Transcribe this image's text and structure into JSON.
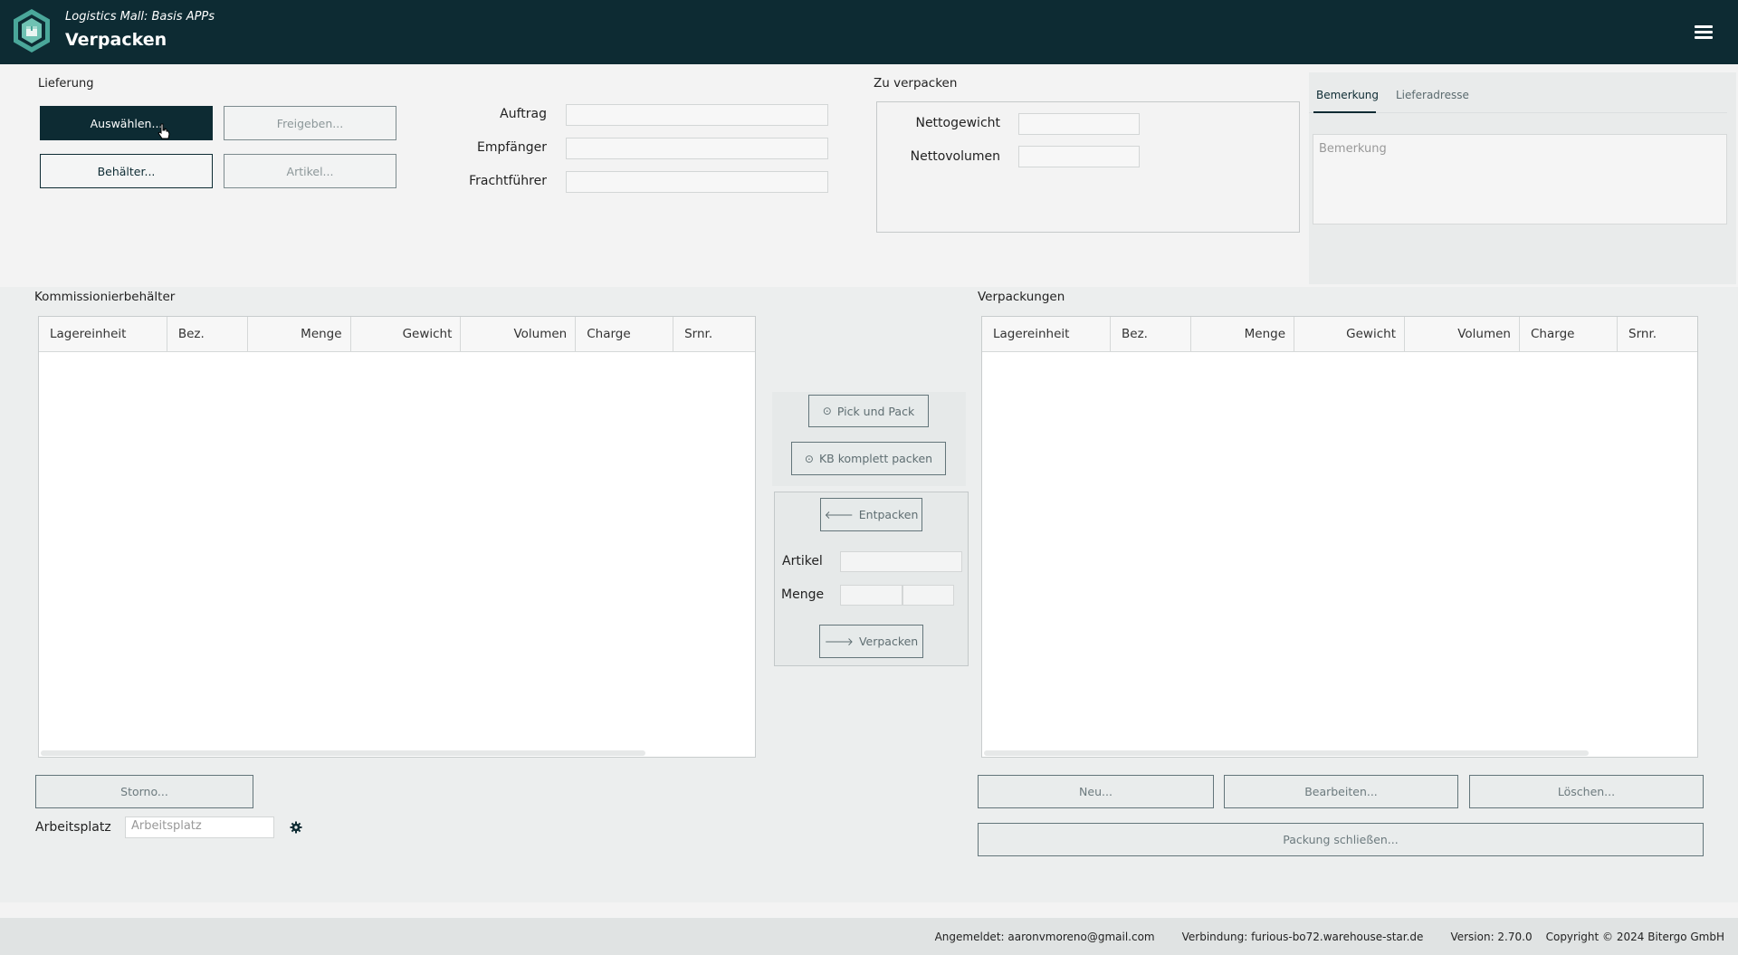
{
  "header": {
    "subtitle": "Logistics Mall: Basis APPs",
    "title": "Verpacken",
    "logo_icon": "box-hexagon-icon",
    "menu_icon": "hamburger-menu-icon"
  },
  "lieferung": {
    "label": "Lieferung",
    "buttons": {
      "auswaehlen": "Auswählen...",
      "freigeben": "Freigeben...",
      "behaelter": "Behälter...",
      "artikel": "Artikel..."
    },
    "fields": {
      "auftrag": "Auftrag",
      "empfaenger": "Empfänger",
      "frachtfuehrer": "Frachtführer"
    }
  },
  "zu_verpacken": {
    "label": "Zu verpacken",
    "nettogewicht": "Nettogewicht",
    "nettovolumen": "Nettovolumen"
  },
  "tabs": {
    "items": [
      "Bemerkung",
      "Lieferadresse"
    ],
    "active": "Bemerkung",
    "bemerkung_placeholder": "Bemerkung"
  },
  "kommissionierbehaelter": {
    "label": "Kommissionierbehälter",
    "columns": [
      "Lagereinheit",
      "Bez.",
      "Menge",
      "Gewicht",
      "Volumen",
      "Charge",
      "Srnr."
    ],
    "rows": []
  },
  "verpackungen": {
    "label": "Verpackungen",
    "columns": [
      "Lagereinheit",
      "Bez.",
      "Menge",
      "Gewicht",
      "Volumen",
      "Charge",
      "Srnr."
    ],
    "rows": []
  },
  "middle": {
    "pick_und_pack": "Pick und Pack",
    "kb_komplett_packen": "KB komplett packen",
    "entpacken": "Entpacken",
    "artikel_label": "Artikel",
    "menge_label": "Menge",
    "verpacken": "Verpacken"
  },
  "bottom_left": {
    "storno": "Storno...",
    "arbeitsplatz_label": "Arbeitsplatz",
    "arbeitsplatz_placeholder": "Arbeitsplatz",
    "settings_icon": "gear-icon"
  },
  "bottom_right": {
    "neu": "Neu...",
    "bearbeiten": "Bearbeiten...",
    "loeschen": "Löschen...",
    "packung_schliessen": "Packung schließen..."
  },
  "footer": {
    "angemeldet": "Angemeldet: aaronvmoreno@gmail.com",
    "verbindung": "Verbindung: furious-bo72.warehouse-star.de",
    "version": "Version: 2.70.0",
    "copyright": "Copyright © 2024 Bitergo GmbH"
  },
  "colors": {
    "header_bg": "#0d2b33",
    "accent": "#0d2b33",
    "logo_teal": "#4aa79a"
  }
}
